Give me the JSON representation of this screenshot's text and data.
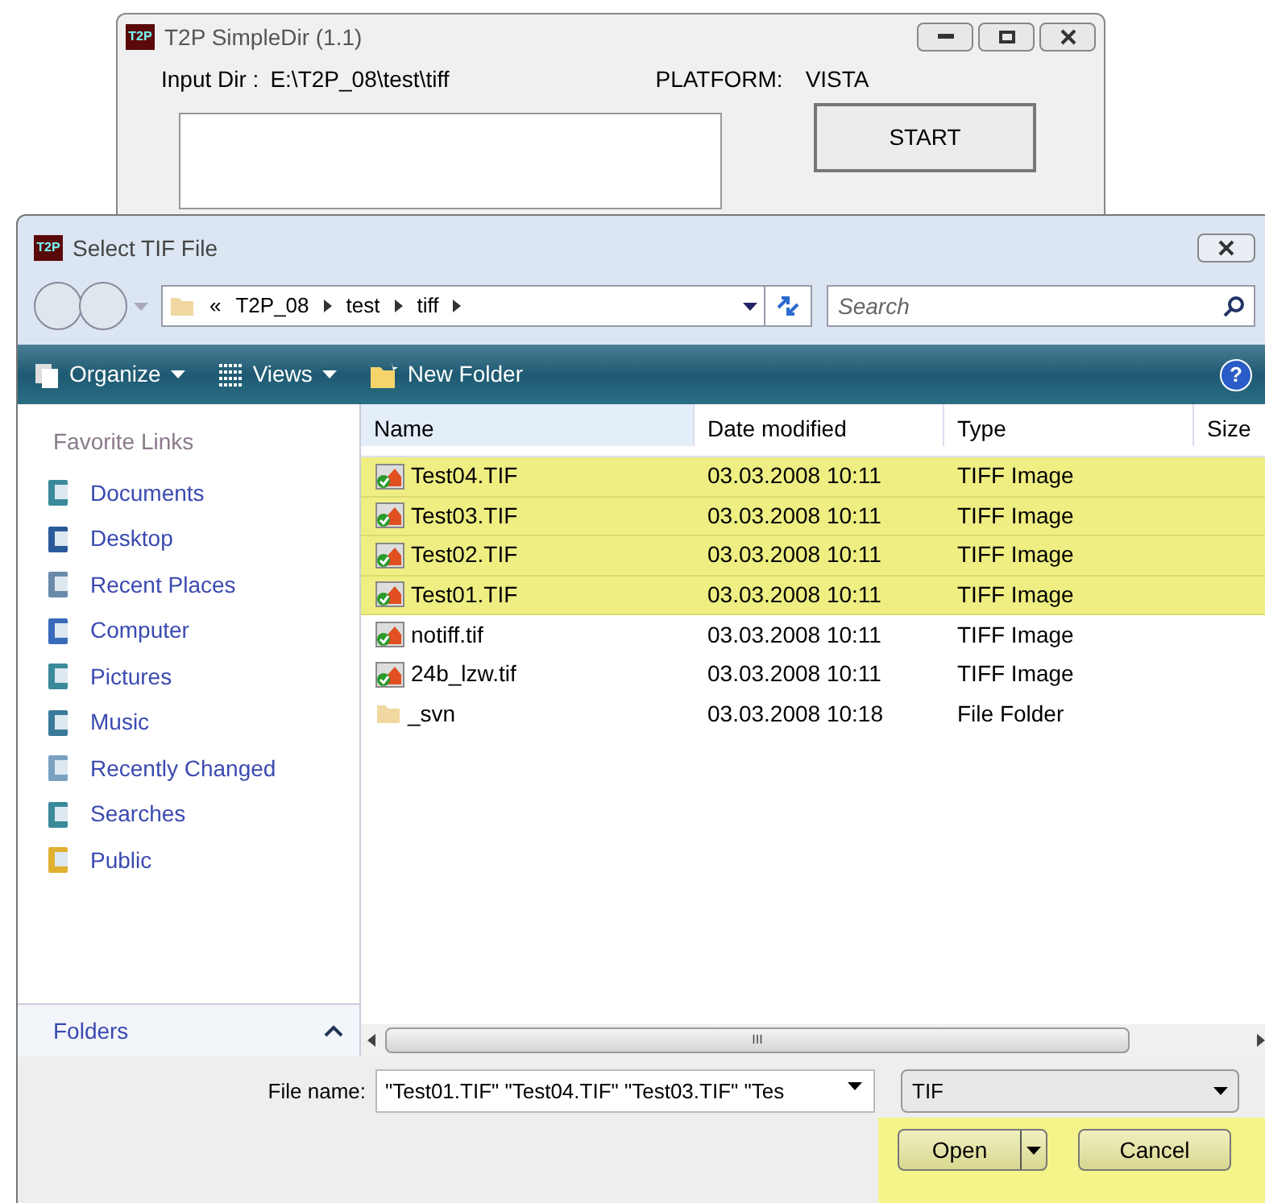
{
  "main_window": {
    "title": "T2P SimpleDir (1.1)",
    "logo": "T2P",
    "input_dir_label": "Input Dir :",
    "input_dir": "E:\\T2P_08\\test\\tiff",
    "platform_label": "PLATFORM:",
    "platform": "VISTA",
    "start_button": "START"
  },
  "dialog": {
    "title": "Select TIF File",
    "logo": "T2P",
    "breadcrumb": {
      "overflow": "«",
      "segments": [
        "T2P_08",
        "test",
        "tiff"
      ]
    },
    "search": {
      "placeholder": "Search"
    },
    "toolbar": [
      {
        "label": "Organize",
        "kind": "menu"
      },
      {
        "label": "Views",
        "kind": "menu"
      },
      {
        "label": "New Folder",
        "kind": "button"
      }
    ],
    "sidebar": {
      "heading": "Favorite Links",
      "items": [
        {
          "label": "Documents"
        },
        {
          "label": "Desktop"
        },
        {
          "label": "Recent Places"
        },
        {
          "label": "Computer"
        },
        {
          "label": "Pictures"
        },
        {
          "label": "Music"
        },
        {
          "label": "Recently Changed"
        },
        {
          "label": "Searches"
        },
        {
          "label": "Public"
        }
      ],
      "folders": "Folders"
    },
    "table": {
      "columns": [
        "Name",
        "Date modified",
        "Type",
        "Size"
      ],
      "rows": [
        {
          "name": "Test04.TIF",
          "date": "03.03.2008 10:11",
          "type": "TIFF Image",
          "kind": "image",
          "selected": true
        },
        {
          "name": "Test03.TIF",
          "date": "03.03.2008 10:11",
          "type": "TIFF Image",
          "kind": "image",
          "selected": true
        },
        {
          "name": "Test02.TIF",
          "date": "03.03.2008 10:11",
          "type": "TIFF Image",
          "kind": "image",
          "selected": true
        },
        {
          "name": "Test01.TIF",
          "date": "03.03.2008 10:11",
          "type": "TIFF Image",
          "kind": "image",
          "selected": true
        },
        {
          "name": "notiff.tif",
          "date": "03.03.2008 10:11",
          "type": "TIFF Image",
          "kind": "image",
          "selected": false
        },
        {
          "name": "24b_lzw.tif",
          "date": "03.03.2008 10:11",
          "type": "TIFF Image",
          "kind": "image",
          "selected": false
        },
        {
          "name": "_svn",
          "date": "03.03.2008 10:18",
          "type": "File Folder",
          "kind": "folder",
          "selected": false
        }
      ]
    },
    "file_name": {
      "label": "File name:",
      "value": "\"Test01.TIF\" \"Test04.TIF\" \"Test03.TIF\" \"Tes"
    },
    "file_type": "TIF",
    "help": "?",
    "open_button": "Open",
    "cancel_button": "Cancel",
    "scroll_grip": "III"
  }
}
